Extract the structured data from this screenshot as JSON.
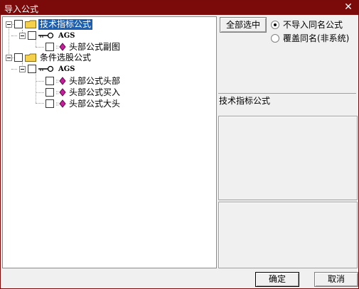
{
  "window": {
    "title": "导入公式",
    "close_glyph": "✕"
  },
  "tree": {
    "group1_label": "技术指标公式",
    "group1_node_label": "AGS",
    "group1_leaf1": "头部公式副图",
    "group2_label": "条件选股公式",
    "group2_node_label": "AGS",
    "group2_leaf1": "头部公式头部",
    "group2_leaf2": "头部公式买入",
    "group2_leaf3": "头部公式大头"
  },
  "options": {
    "select_all_label": "全部选中",
    "radio_skip_label": "不导入同名公式",
    "radio_overwrite_label": "覆盖同名(非系统)",
    "selected": "skip"
  },
  "info": {
    "category_text": "技术指标公式"
  },
  "footer": {
    "ok_label": "确定",
    "cancel_label": "取消"
  },
  "colors": {
    "titlebar": "#7b0a0a",
    "selection": "#1c5fb0",
    "folder": "#f5d04a",
    "gem": "#c51e9a"
  },
  "icons": {
    "folder": "folder-icon",
    "formula_node": "key-icon",
    "formula_leaf": "gem-icon",
    "close": "close-icon"
  }
}
